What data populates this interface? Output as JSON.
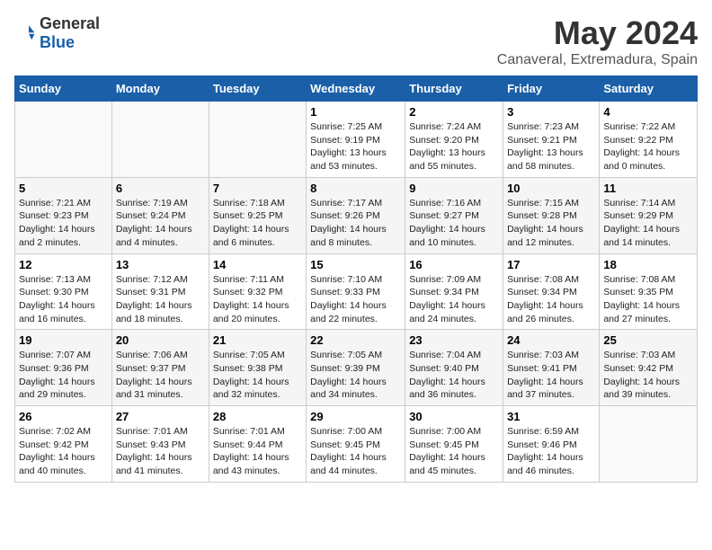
{
  "logo": {
    "general": "General",
    "blue": "Blue"
  },
  "title": "May 2024",
  "location": "Canaveral, Extremadura, Spain",
  "weekdays": [
    "Sunday",
    "Monday",
    "Tuesday",
    "Wednesday",
    "Thursday",
    "Friday",
    "Saturday"
  ],
  "weeks": [
    [
      {
        "day": "",
        "info": ""
      },
      {
        "day": "",
        "info": ""
      },
      {
        "day": "",
        "info": ""
      },
      {
        "day": "1",
        "info": "Sunrise: 7:25 AM\nSunset: 9:19 PM\nDaylight: 13 hours and 53 minutes."
      },
      {
        "day": "2",
        "info": "Sunrise: 7:24 AM\nSunset: 9:20 PM\nDaylight: 13 hours and 55 minutes."
      },
      {
        "day": "3",
        "info": "Sunrise: 7:23 AM\nSunset: 9:21 PM\nDaylight: 13 hours and 58 minutes."
      },
      {
        "day": "4",
        "info": "Sunrise: 7:22 AM\nSunset: 9:22 PM\nDaylight: 14 hours and 0 minutes."
      }
    ],
    [
      {
        "day": "5",
        "info": "Sunrise: 7:21 AM\nSunset: 9:23 PM\nDaylight: 14 hours and 2 minutes."
      },
      {
        "day": "6",
        "info": "Sunrise: 7:19 AM\nSunset: 9:24 PM\nDaylight: 14 hours and 4 minutes."
      },
      {
        "day": "7",
        "info": "Sunrise: 7:18 AM\nSunset: 9:25 PM\nDaylight: 14 hours and 6 minutes."
      },
      {
        "day": "8",
        "info": "Sunrise: 7:17 AM\nSunset: 9:26 PM\nDaylight: 14 hours and 8 minutes."
      },
      {
        "day": "9",
        "info": "Sunrise: 7:16 AM\nSunset: 9:27 PM\nDaylight: 14 hours and 10 minutes."
      },
      {
        "day": "10",
        "info": "Sunrise: 7:15 AM\nSunset: 9:28 PM\nDaylight: 14 hours and 12 minutes."
      },
      {
        "day": "11",
        "info": "Sunrise: 7:14 AM\nSunset: 9:29 PM\nDaylight: 14 hours and 14 minutes."
      }
    ],
    [
      {
        "day": "12",
        "info": "Sunrise: 7:13 AM\nSunset: 9:30 PM\nDaylight: 14 hours and 16 minutes."
      },
      {
        "day": "13",
        "info": "Sunrise: 7:12 AM\nSunset: 9:31 PM\nDaylight: 14 hours and 18 minutes."
      },
      {
        "day": "14",
        "info": "Sunrise: 7:11 AM\nSunset: 9:32 PM\nDaylight: 14 hours and 20 minutes."
      },
      {
        "day": "15",
        "info": "Sunrise: 7:10 AM\nSunset: 9:33 PM\nDaylight: 14 hours and 22 minutes."
      },
      {
        "day": "16",
        "info": "Sunrise: 7:09 AM\nSunset: 9:34 PM\nDaylight: 14 hours and 24 minutes."
      },
      {
        "day": "17",
        "info": "Sunrise: 7:08 AM\nSunset: 9:34 PM\nDaylight: 14 hours and 26 minutes."
      },
      {
        "day": "18",
        "info": "Sunrise: 7:08 AM\nSunset: 9:35 PM\nDaylight: 14 hours and 27 minutes."
      }
    ],
    [
      {
        "day": "19",
        "info": "Sunrise: 7:07 AM\nSunset: 9:36 PM\nDaylight: 14 hours and 29 minutes."
      },
      {
        "day": "20",
        "info": "Sunrise: 7:06 AM\nSunset: 9:37 PM\nDaylight: 14 hours and 31 minutes."
      },
      {
        "day": "21",
        "info": "Sunrise: 7:05 AM\nSunset: 9:38 PM\nDaylight: 14 hours and 32 minutes."
      },
      {
        "day": "22",
        "info": "Sunrise: 7:05 AM\nSunset: 9:39 PM\nDaylight: 14 hours and 34 minutes."
      },
      {
        "day": "23",
        "info": "Sunrise: 7:04 AM\nSunset: 9:40 PM\nDaylight: 14 hours and 36 minutes."
      },
      {
        "day": "24",
        "info": "Sunrise: 7:03 AM\nSunset: 9:41 PM\nDaylight: 14 hours and 37 minutes."
      },
      {
        "day": "25",
        "info": "Sunrise: 7:03 AM\nSunset: 9:42 PM\nDaylight: 14 hours and 39 minutes."
      }
    ],
    [
      {
        "day": "26",
        "info": "Sunrise: 7:02 AM\nSunset: 9:42 PM\nDaylight: 14 hours and 40 minutes."
      },
      {
        "day": "27",
        "info": "Sunrise: 7:01 AM\nSunset: 9:43 PM\nDaylight: 14 hours and 41 minutes."
      },
      {
        "day": "28",
        "info": "Sunrise: 7:01 AM\nSunset: 9:44 PM\nDaylight: 14 hours and 43 minutes."
      },
      {
        "day": "29",
        "info": "Sunrise: 7:00 AM\nSunset: 9:45 PM\nDaylight: 14 hours and 44 minutes."
      },
      {
        "day": "30",
        "info": "Sunrise: 7:00 AM\nSunset: 9:45 PM\nDaylight: 14 hours and 45 minutes."
      },
      {
        "day": "31",
        "info": "Sunrise: 6:59 AM\nSunset: 9:46 PM\nDaylight: 14 hours and 46 minutes."
      },
      {
        "day": "",
        "info": ""
      }
    ]
  ]
}
